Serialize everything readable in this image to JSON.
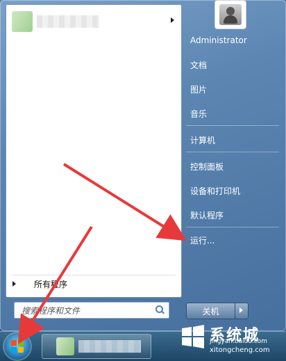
{
  "start_menu": {
    "left_panel": {
      "all_programs_label": "所有程序",
      "search_placeholder": "搜索程序和文件"
    },
    "right_panel": {
      "items": [
        {
          "label": "Administrator"
        },
        {
          "label": "文档"
        },
        {
          "label": "图片"
        },
        {
          "label": "音乐"
        },
        {
          "label": "计算机"
        },
        {
          "label": "控制面板"
        },
        {
          "label": "设备和打印机"
        },
        {
          "label": "默认程序"
        },
        {
          "label": "运行..."
        }
      ]
    },
    "shutdown": {
      "label": "关机"
    }
  },
  "watermark": {
    "title": "系统城",
    "line1": "jingyan.baidu.com",
    "line2": "xitongcheng.com"
  },
  "colors": {
    "annotation_arrow": "#e8393a",
    "menu_blue": "#5d86b3"
  },
  "icons": [
    "search-icon",
    "start-orb-icon",
    "user-avatar-icon",
    "chevron-right-icon"
  ]
}
